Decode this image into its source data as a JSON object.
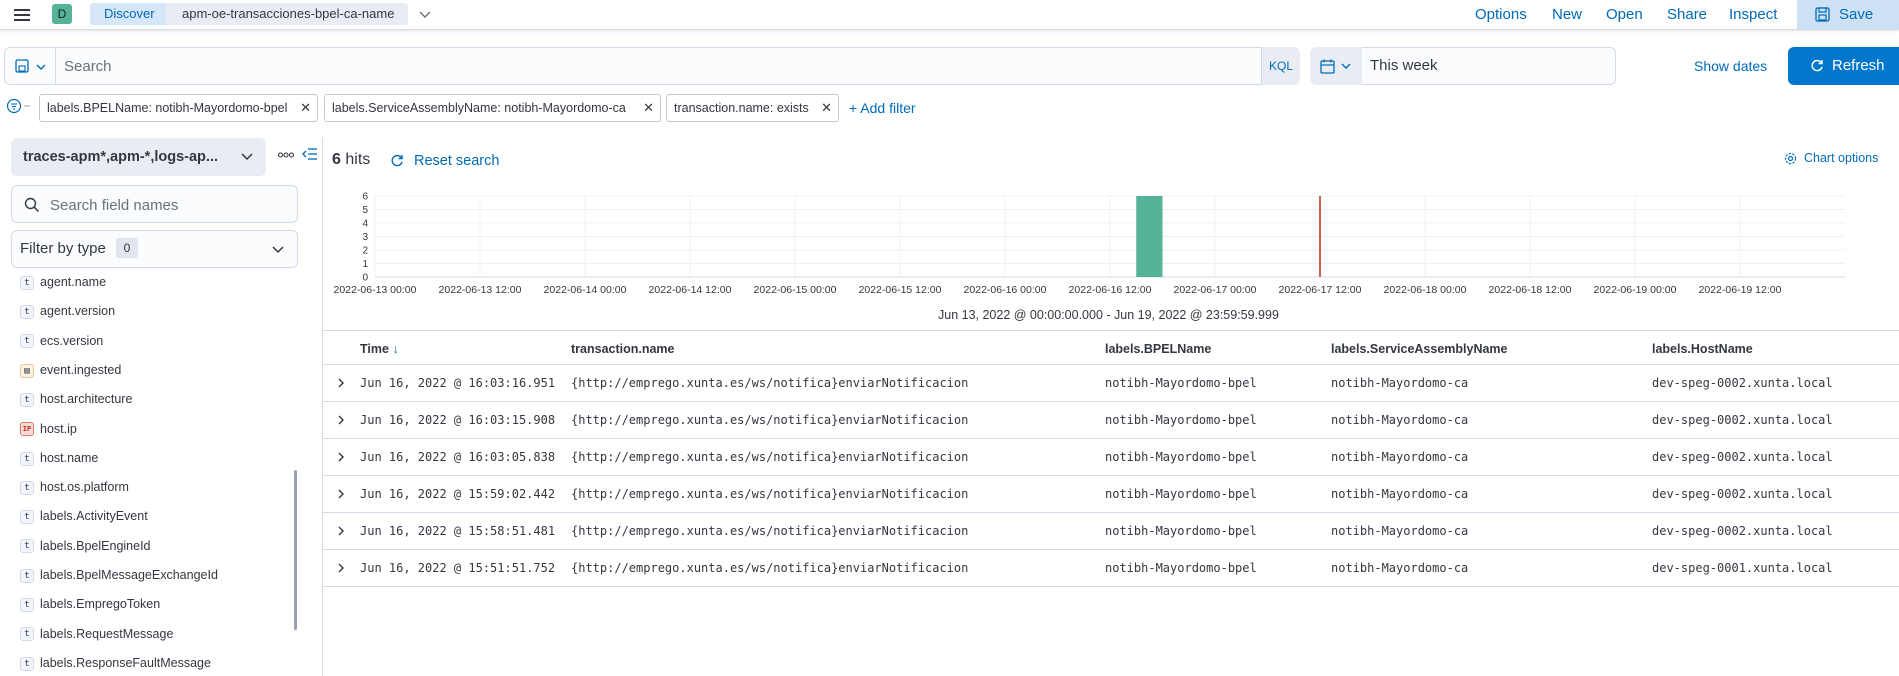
{
  "header": {
    "space_initial": "D",
    "breadcrumbs": [
      "Discover",
      "apm-oe-transacciones-bpel-ca-name"
    ],
    "links": [
      "Options",
      "New",
      "Open",
      "Share",
      "Inspect"
    ],
    "save_label": "Save"
  },
  "query": {
    "placeholder": "Search",
    "language": "KQL",
    "date_range": "This week",
    "show_dates": "Show dates",
    "refresh_label": "Refresh"
  },
  "filters": {
    "pills": [
      "labels.BPELName: notibh-Mayordomo-bpel",
      "labels.ServiceAssemblyName: notibh-Mayordomo-ca",
      "transaction.name: exists"
    ],
    "add_filter": "+ Add filter"
  },
  "sidebar": {
    "index_pattern": "traces-apm*,apm-*,logs-ap...",
    "field_search_placeholder": "Search field names",
    "filter_by_type": "Filter by type",
    "filter_count": "0",
    "fields": [
      {
        "name": "agent.name",
        "type": "t"
      },
      {
        "name": "agent.version",
        "type": "t"
      },
      {
        "name": "ecs.version",
        "type": "t"
      },
      {
        "name": "event.ingested",
        "type": "date"
      },
      {
        "name": "host.architecture",
        "type": "t"
      },
      {
        "name": "host.ip",
        "type": "ip"
      },
      {
        "name": "host.name",
        "type": "t"
      },
      {
        "name": "host.os.platform",
        "type": "t"
      },
      {
        "name": "labels.ActivityEvent",
        "type": "t"
      },
      {
        "name": "labels.BpelEngineId",
        "type": "t"
      },
      {
        "name": "labels.BpelMessageExchangeId",
        "type": "t"
      },
      {
        "name": "labels.EmpregoToken",
        "type": "t"
      },
      {
        "name": "labels.RequestMessage",
        "type": "t"
      },
      {
        "name": "labels.ResponseFaultMessage",
        "type": "t"
      }
    ]
  },
  "main": {
    "hits_count": "6",
    "hits_label": "hits",
    "reset_search": "Reset search",
    "chart_options": "Chart options",
    "time_range_label": "Jun 13, 2022 @ 00:00:00.000 - Jun 19, 2022 @ 23:59:59.999",
    "columns": [
      "Time",
      "transaction.name",
      "labels.BPELName",
      "labels.ServiceAssemblyName",
      "labels.HostName"
    ],
    "rows": [
      [
        "Jun 16, 2022 @ 16:03:16.951",
        "{http://emprego.xunta.es/ws/notifica}enviarNotificacion",
        "notibh-Mayordomo-bpel",
        "notibh-Mayordomo-ca",
        "dev-speg-0002.xunta.local"
      ],
      [
        "Jun 16, 2022 @ 16:03:15.908",
        "{http://emprego.xunta.es/ws/notifica}enviarNotificacion",
        "notibh-Mayordomo-bpel",
        "notibh-Mayordomo-ca",
        "dev-speg-0002.xunta.local"
      ],
      [
        "Jun 16, 2022 @ 16:03:05.838",
        "{http://emprego.xunta.es/ws/notifica}enviarNotificacion",
        "notibh-Mayordomo-bpel",
        "notibh-Mayordomo-ca",
        "dev-speg-0002.xunta.local"
      ],
      [
        "Jun 16, 2022 @ 15:59:02.442",
        "{http://emprego.xunta.es/ws/notifica}enviarNotificacion",
        "notibh-Mayordomo-bpel",
        "notibh-Mayordomo-ca",
        "dev-speg-0002.xunta.local"
      ],
      [
        "Jun 16, 2022 @ 15:58:51.481",
        "{http://emprego.xunta.es/ws/notifica}enviarNotificacion",
        "notibh-Mayordomo-bpel",
        "notibh-Mayordomo-ca",
        "dev-speg-0002.xunta.local"
      ],
      [
        "Jun 16, 2022 @ 15:51:51.752",
        "{http://emprego.xunta.es/ws/notifica}enviarNotificacion",
        "notibh-Mayordomo-bpel",
        "notibh-Mayordomo-ca",
        "dev-speg-0001.xunta.local"
      ]
    ]
  },
  "chart_data": {
    "type": "bar",
    "x_ticks": [
      "2022-06-13 00:00",
      "2022-06-13 12:00",
      "2022-06-14 00:00",
      "2022-06-14 12:00",
      "2022-06-15 00:00",
      "2022-06-15 12:00",
      "2022-06-16 00:00",
      "2022-06-16 12:00",
      "2022-06-17 00:00",
      "2022-06-17 12:00",
      "2022-06-18 00:00",
      "2022-06-18 12:00",
      "2022-06-19 00:00",
      "2022-06-19 12:00"
    ],
    "y_ticks": [
      0,
      1,
      2,
      3,
      4,
      5,
      6
    ],
    "ylim": [
      0,
      6
    ],
    "xlim": [
      "2022-06-13 00:00",
      "2022-06-20 00:00"
    ],
    "bars": [
      {
        "start": "2022-06-16 15:00",
        "end": "2022-06-16 18:00",
        "value": 6
      }
    ],
    "now_marker": "2022-06-17 12:00",
    "bar_color": "#54b399",
    "marker_color": "#bd271e",
    "grid": true
  }
}
